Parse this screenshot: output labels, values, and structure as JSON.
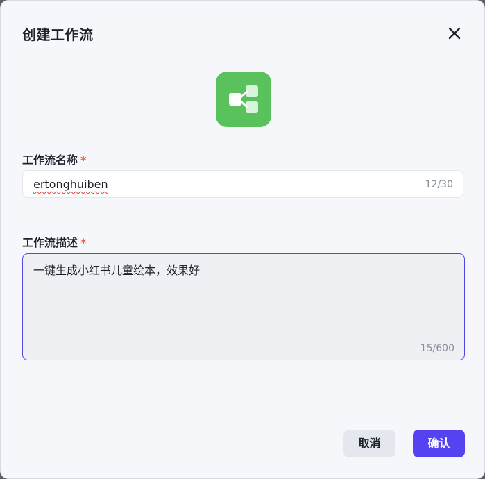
{
  "dialog": {
    "title": "创建工作流",
    "close_icon": "close-icon",
    "app_icon": "workflow-icon",
    "app_icon_color": "#5ac25c"
  },
  "form": {
    "name": {
      "label": "工作流名称",
      "required_mark": "*",
      "value": "ertonghuiben",
      "counter": "12/30"
    },
    "description": {
      "label": "工作流描述",
      "required_mark": "*",
      "value": "一键生成小红书儿童绘本，效果好",
      "counter": "15/600"
    }
  },
  "actions": {
    "cancel_label": "取消",
    "confirm_label": "确认",
    "confirm_color": "#5543f2"
  }
}
